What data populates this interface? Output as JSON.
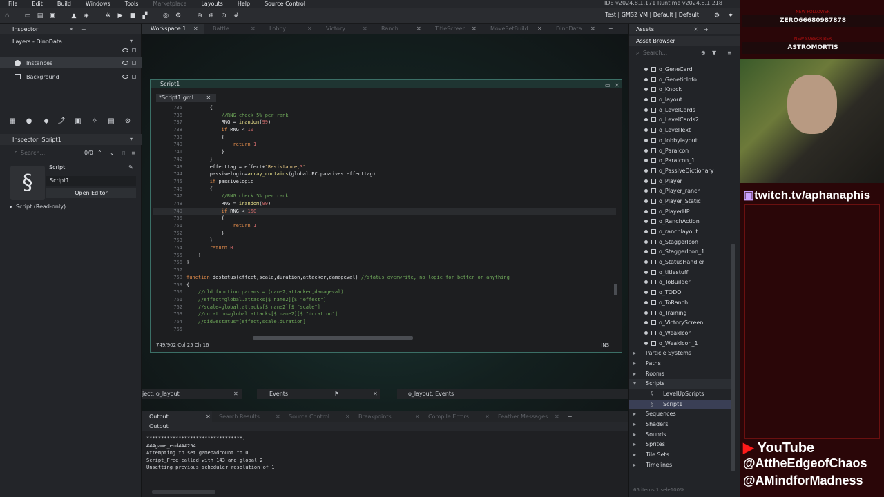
{
  "app": {
    "version_text": "IDE v2024.8.1.171 Runtime v2024.8.1.218",
    "target_text": "Test | GMS2 VM | Default | Default"
  },
  "menu": [
    "File",
    "Edit",
    "Build",
    "Windows",
    "Tools",
    "Marketplace",
    "Layouts",
    "Help",
    "Source Control"
  ],
  "inspector": {
    "title": "Inspector",
    "layers_title": "Layers - DinoData",
    "layers": [
      "Instances",
      "Background"
    ],
    "props_title": "Inspector: Script1",
    "search_placeholder": "Search...",
    "counter": "0/0",
    "obj_type": "Script",
    "obj_name": "Script1",
    "open_editor": "Open Editor",
    "section": "Script (Read-only)"
  },
  "workspace_tabs": [
    "Workspace 1",
    "Battle",
    "Lobby",
    "Victory",
    "Ranch",
    "TitleScreen",
    "MoveSetBuild...",
    "DinoData"
  ],
  "script_window": {
    "title": "Script1",
    "file_tab": "*Script1.gml",
    "status": "749/902 Col:25 Ch:16",
    "mode": "INS"
  },
  "code_lines": [
    {
      "n": "735",
      "t": "        {"
    },
    {
      "n": "736",
      "t": "            //RNG check 5% per rank"
    },
    {
      "n": "737",
      "t": "            RNG = irandom(99)"
    },
    {
      "n": "738",
      "t": "            if RNG < 10"
    },
    {
      "n": "739",
      "t": "            {"
    },
    {
      "n": "740",
      "t": "                return 1"
    },
    {
      "n": "741",
      "t": "            }"
    },
    {
      "n": "742",
      "t": "        }"
    },
    {
      "n": "743",
      "t": "        effecttag = effect+\"Resistance,3\""
    },
    {
      "n": "744",
      "t": "        passivelogic=array_contains(global.PC.passives,effecttag)"
    },
    {
      "n": "745",
      "t": "        if passivelogic"
    },
    {
      "n": "746",
      "t": "        {"
    },
    {
      "n": "747",
      "t": "            //RNG check 5% per rank"
    },
    {
      "n": "748",
      "t": "            RNG = irandom(99)"
    },
    {
      "n": "749",
      "t": "            if RNG < 150"
    },
    {
      "n": "750",
      "t": "            {"
    },
    {
      "n": "751",
      "t": "                return 1"
    },
    {
      "n": "752",
      "t": "            }"
    },
    {
      "n": "753",
      "t": "        }"
    },
    {
      "n": "754",
      "t": "        return 0"
    },
    {
      "n": "755",
      "t": "    }"
    },
    {
      "n": "756",
      "t": "}"
    },
    {
      "n": "757",
      "t": ""
    },
    {
      "n": "758",
      "t": "function dostatus(effect,scale,duration,attacker,damageval) //status overwrite, no logic for better or anything"
    },
    {
      "n": "759",
      "t": "{"
    },
    {
      "n": "760",
      "t": "    //old function params = (name2,attacker,damageval)"
    },
    {
      "n": "761",
      "t": "    //effect=global.attacks[$ name2][$ \"effect\"]"
    },
    {
      "n": "762",
      "t": "    //scale=global.attacks[$ name2][$ \"scale\"]"
    },
    {
      "n": "763",
      "t": "    //duration=global.attacks[$ name2][$ \"duration\"]"
    },
    {
      "n": "764",
      "t": "    //didwestatus=[effect,scale,duration]"
    },
    {
      "n": "765",
      "t": ""
    }
  ],
  "mini_panels": {
    "object": "ject: o_layout",
    "events": "Events",
    "layout_events": "o_layout: Events"
  },
  "bottom_tabs": [
    "Output",
    "Search Results",
    "Source Control",
    "Breakpoints",
    "Compile Errors",
    "Feather Messages"
  ],
  "output": {
    "label": "Output",
    "lines": [
      "*********************************.",
      "###game_end###254",
      "Attempting to set gamepadcount to 0",
      "Script_Free called with 143 and global 2",
      "Unsetting previous scheduler resolution of 1"
    ]
  },
  "assets": {
    "title": "Assets",
    "browser": "Asset Browser",
    "search_placeholder": "Search...",
    "objects": [
      "o_GeneCard",
      "o_GeneticInfo",
      "o_Knock",
      "o_layout",
      "o_LevelCards",
      "o_LevelCards2",
      "o_LevelText",
      "o_lobbylayout",
      "o_ParaIcon",
      "o_ParaIcon_1",
      "o_PassiveDictionary",
      "o_Player",
      "o_Player_ranch",
      "o_Player_Static",
      "o_PlayerHP",
      "o_RanchAction",
      "o_ranchlayout",
      "o_StaggerIcon",
      "o_StaggerIcon_1",
      "o_StatusHandler",
      "o_titlestuff",
      "o_ToBuilder",
      "o_TODO",
      "o_ToRanch",
      "o_Training",
      "o_VictoryScreen",
      "o_WeakIcon",
      "o_WeakIcon_1"
    ],
    "groups": [
      "Particle Systems",
      "Paths",
      "Rooms",
      "Scripts",
      "LevelUpScripts",
      "Script1",
      "Sequences",
      "Shaders",
      "Sounds",
      "Sprites",
      "Tile Sets",
      "Timelines"
    ],
    "footer": "65 items  1 sele100%"
  },
  "stream": {
    "follower_label": "NEW FOLLOWER",
    "follower": "ZERO66680987878",
    "sub_label": "NEW SUBSCRIBER",
    "subscriber": "ASTROMORTIS",
    "twitch": "twitch.tv/aphanaphis",
    "youtube": "YouTube",
    "handle1": "@AttheEdgeofChaos",
    "handle2": "@AMindforMadness"
  },
  "colors": {
    "accent": "#3b6f66",
    "stream_bg": "#2a0608"
  }
}
